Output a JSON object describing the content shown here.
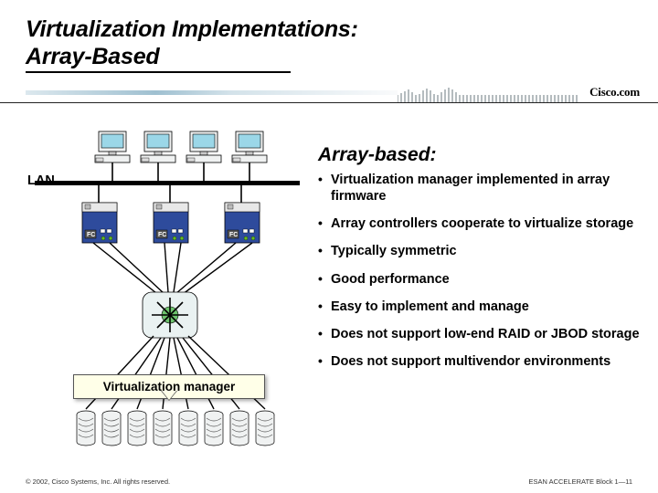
{
  "title_line1": "Virtualization Implementations:",
  "title_line2": "Array-Based",
  "brand": "Cisco.com",
  "subtitle": "Array-based:",
  "lan_label": "LAN",
  "fc_label": "FC",
  "vm_label": "Virtualization manager",
  "bullets": [
    "Virtualization manager implemented in array firmware",
    "Array controllers cooperate to virtualize storage",
    "Typically symmetric",
    "Good performance",
    "Easy to implement and manage",
    "Does not support low-end RAID or JBOD storage",
    "Does not support multivendor environments"
  ],
  "footer_left": "© 2002, Cisco Systems, Inc. All rights reserved.",
  "footer_right": "ESAN ACCELERATE Block 1—11"
}
